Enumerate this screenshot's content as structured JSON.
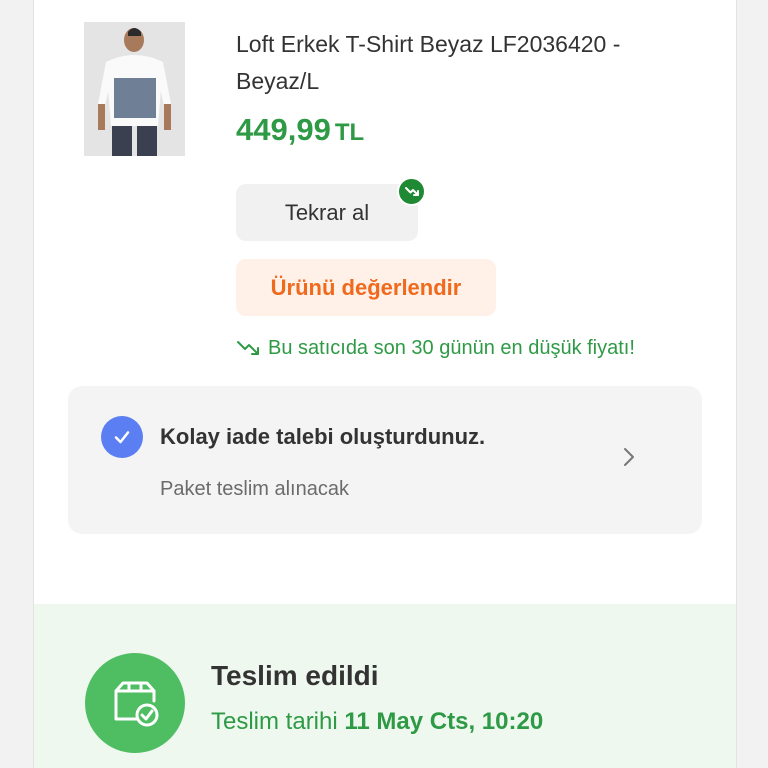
{
  "product": {
    "image_icon": "tshirt-model-photo",
    "title": "Loft Erkek T-Shirt Beyaz LF2036420 - Beyaz/L",
    "price": "449,99",
    "currency": "TL"
  },
  "actions": {
    "rebuy_label": "Tekrar al",
    "rebuy_badge_icon": "price-down-icon",
    "rate_label": "Ürünü değerlendir"
  },
  "price_note": {
    "icon": "trend-down-icon",
    "text": "Bu satıcıda son 30 günün en düşük fiyatı!"
  },
  "return_request": {
    "icon": "check-icon",
    "title": "Kolay iade talebi oluşturdunuz.",
    "subtitle": "Paket teslim alınacak",
    "chevron_icon": "chevron-right-icon"
  },
  "delivery": {
    "icon": "package-delivered-icon",
    "title": "Teslim edildi",
    "date_label": "Teslim tarihi",
    "date_value": "11 May Cts, 10:20"
  },
  "colors": {
    "green": "#2e9a45",
    "orange": "#f06a1e",
    "blue": "#5b7ff2",
    "delivery_bg": "#eef8ef"
  }
}
